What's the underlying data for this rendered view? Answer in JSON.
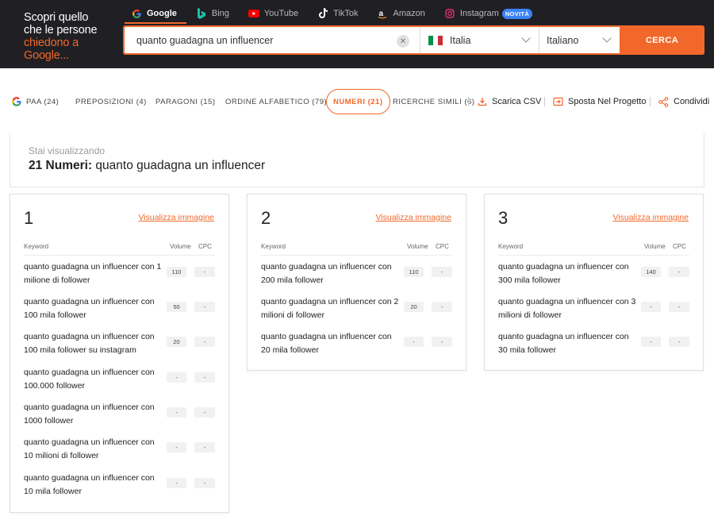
{
  "header": {
    "tagline_line1": "Scopri quello",
    "tagline_line2": "che le persone",
    "tagline_accent1": "chiedono a",
    "tagline_accent2": "Google...",
    "engines": [
      {
        "label": "Google",
        "icon": "google-icon"
      },
      {
        "label": "Bing",
        "icon": "bing-icon"
      },
      {
        "label": "YouTube",
        "icon": "youtube-icon"
      },
      {
        "label": "TikTok",
        "icon": "tiktok-icon"
      },
      {
        "label": "Amazon",
        "icon": "amazon-icon"
      },
      {
        "label": "Instagram",
        "icon": "instagram-icon",
        "badge": "NOVITÀ"
      }
    ],
    "search_value": "quanto guadagna un influencer",
    "country": "Italia",
    "language": "Italiano",
    "search_button": "CERCA",
    "accent_color": "#f2682b"
  },
  "tabs": [
    {
      "label": "PAA (24)"
    },
    {
      "label": "PREPOSIZIONI (4)"
    },
    {
      "label": "PARAGONI (15)"
    },
    {
      "label": "ORDINE ALFABETICO (79)"
    },
    {
      "label": "NUMERI (21)",
      "active": true
    },
    {
      "label": "RICERCHE SIMILI (6)"
    }
  ],
  "actions": {
    "download": "Scarica CSV",
    "move": "Sposta Nel Progetto",
    "share": "Condividi"
  },
  "info": {
    "subtitle": "Stai visualizzando",
    "title_bold": "21 Numeri:",
    "title_rest": " quanto guadagna un influencer"
  },
  "table_headers": {
    "keyword": "Keyword",
    "volume": "Volume",
    "cpc": "CPC"
  },
  "view_image_label": "Visualizza immagine",
  "cards": [
    {
      "number": "1",
      "rows": [
        {
          "line1": "quanto guadagna un influencer con 1",
          "line2": "milione di follower",
          "volume": "110",
          "cpc": "-"
        },
        {
          "line1": "quanto guadagna un influencer con",
          "line2": "100 mila follower",
          "volume": "50",
          "cpc": "-"
        },
        {
          "line1": "quanto guadagna un influencer con",
          "line2": "100 mila follower su instagram",
          "volume": "20",
          "cpc": "-"
        },
        {
          "line1": "quanto guadagna un influencer con",
          "line2": "100.000 follower",
          "volume": "-",
          "cpc": "-"
        },
        {
          "line1": "quanto guadagna un influencer con",
          "line2": "1000 follower",
          "volume": "-",
          "cpc": "-"
        },
        {
          "line1": "quanto guadagna un influencer con",
          "line2": "10 milioni di follower",
          "volume": "-",
          "cpc": "-"
        },
        {
          "line1": "quanto guadagna un influencer con",
          "line2": "10 mila follower",
          "volume": "-",
          "cpc": "-"
        }
      ]
    },
    {
      "number": "2",
      "rows": [
        {
          "line1": "quanto guadagna un influencer con",
          "line2": "200 mila follower",
          "volume": "110",
          "cpc": "-"
        },
        {
          "line1": "quanto guadagna un influencer con 2",
          "line2": "milioni di follower",
          "volume": "20",
          "cpc": "-"
        },
        {
          "line1": "quanto guadagna un influencer con",
          "line2": "20 mila follower",
          "volume": "-",
          "cpc": "-"
        }
      ]
    },
    {
      "number": "3",
      "rows": [
        {
          "line1": "quanto guadagna un influencer con",
          "line2": "300 mila follower",
          "volume": "140",
          "cpc": "-"
        },
        {
          "line1": "quanto guadagna un influencer con 3",
          "line2": "milioni di follower",
          "volume": "-",
          "cpc": "-"
        },
        {
          "line1": "quanto guadagna un influencer con",
          "line2": "30 mila follower",
          "volume": "-",
          "cpc": "-"
        }
      ]
    }
  ]
}
